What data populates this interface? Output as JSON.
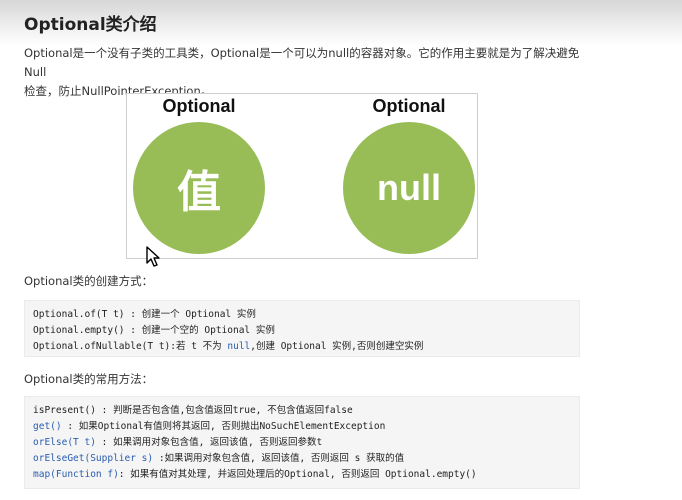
{
  "page": {
    "title": "Optional类介绍",
    "intro_line1": "Optional是一个没有子类的工具类，Optional是一个可以为null的容器对象。它的作用主要就是为了解决避免Null",
    "intro_line2": "检查，防止NullPointerException。"
  },
  "figure": {
    "left_label": "Optional",
    "left_value": "值",
    "right_label": "Optional",
    "right_value": "null",
    "circle_color": "#98bd57"
  },
  "creation": {
    "heading": "Optional类的创建方式：",
    "lines": [
      {
        "code": "Optional.of(T t)",
        "desc": " : 创建一个 Optional 实例"
      },
      {
        "code": "Optional.empty()",
        "desc": " : 创建一个空的 Optional 实例"
      },
      {
        "pre": "Optional.ofNullable(T t):若 t 不为 ",
        "kw": "null",
        "post": ",创建 Optional 实例,否则创建空实例"
      }
    ]
  },
  "methods": {
    "heading": "Optional类的常用方法：",
    "lines": [
      {
        "name": "isPresent()",
        "desc": " : 判断是否包含值,包含值返回true, 不包含值返回false"
      },
      {
        "name": "get()",
        "desc": " : 如果Optional有值则将其返回, 否则抛出NoSuchElementException"
      },
      {
        "name": "orElse(T t)",
        "desc": " :  如果调用对象包含值, 返回该值, 否则返回参数t"
      },
      {
        "name": "orElseGet(Supplier s)",
        "desc": " :如果调用对象包含值, 返回该值, 否则返回 s 获取的值"
      },
      {
        "name": "map(Function f)",
        "desc": ": 如果有值对其处理, 并返回处理后的Optional, 否则返回 Optional.empty()"
      }
    ]
  }
}
